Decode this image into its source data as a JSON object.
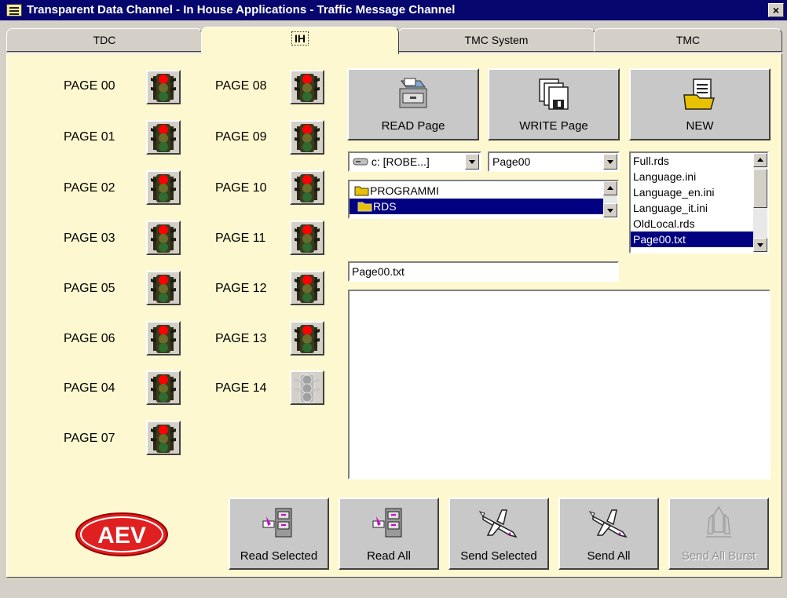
{
  "window": {
    "title": "Transparent Data Channel - In House Applications - Traffic Message Channel",
    "close_label": "×"
  },
  "tabs": [
    {
      "label": "TDC",
      "active": false
    },
    {
      "label": "IH",
      "active": true
    },
    {
      "label": "TMC System",
      "active": false
    },
    {
      "label": "TMC",
      "active": false
    }
  ],
  "pages_left": [
    {
      "label": "PAGE 00",
      "state": "red"
    },
    {
      "label": "PAGE 01",
      "state": "red"
    },
    {
      "label": "PAGE 02",
      "state": "red"
    },
    {
      "label": "PAGE 03",
      "state": "red"
    },
    {
      "label": "PAGE 05",
      "state": "red"
    },
    {
      "label": "PAGE 06",
      "state": "red"
    },
    {
      "label": "PAGE 04",
      "state": "red"
    },
    {
      "label": "PAGE 07",
      "state": "red"
    }
  ],
  "pages_right": [
    {
      "label": "PAGE 08",
      "state": "red"
    },
    {
      "label": "PAGE 09",
      "state": "red"
    },
    {
      "label": "PAGE 10",
      "state": "red"
    },
    {
      "label": "PAGE 11",
      "state": "red"
    },
    {
      "label": "PAGE 12",
      "state": "red"
    },
    {
      "label": "PAGE 13",
      "state": "red"
    },
    {
      "label": "PAGE 14",
      "state": "disabled"
    }
  ],
  "file_buttons": {
    "read": "READ Page",
    "write": "WRITE Page",
    "new": "NEW"
  },
  "drive_combo": {
    "value": "c: [ROBE...]"
  },
  "page_combo": {
    "value": "Page00"
  },
  "folders": [
    {
      "label": "PROGRAMMI",
      "selected": false
    },
    {
      "label": "RDS",
      "selected": true
    }
  ],
  "files": [
    {
      "label": "Full.rds",
      "selected": false
    },
    {
      "label": "Language.ini",
      "selected": false
    },
    {
      "label": "Language_en.ini",
      "selected": false
    },
    {
      "label": "Language_it.ini",
      "selected": false
    },
    {
      "label": "OldLocal.rds",
      "selected": false
    },
    {
      "label": "Page00.txt",
      "selected": true
    }
  ],
  "filename_field": {
    "value": "Page00.txt"
  },
  "content_area": {
    "value": ""
  },
  "action_buttons": {
    "read_selected": "Read Selected",
    "read_all": "Read All",
    "send_selected": "Send Selected",
    "send_all": "Send All",
    "send_all_burst": "Send All Burst"
  },
  "logo": {
    "text": "AEV"
  },
  "colors": {
    "panel_bg": "#fdf8cf",
    "titlebar_bg": "#06066e",
    "selection": "#000080",
    "light_red": "#ff0000",
    "light_dark": "#1b1b10"
  }
}
